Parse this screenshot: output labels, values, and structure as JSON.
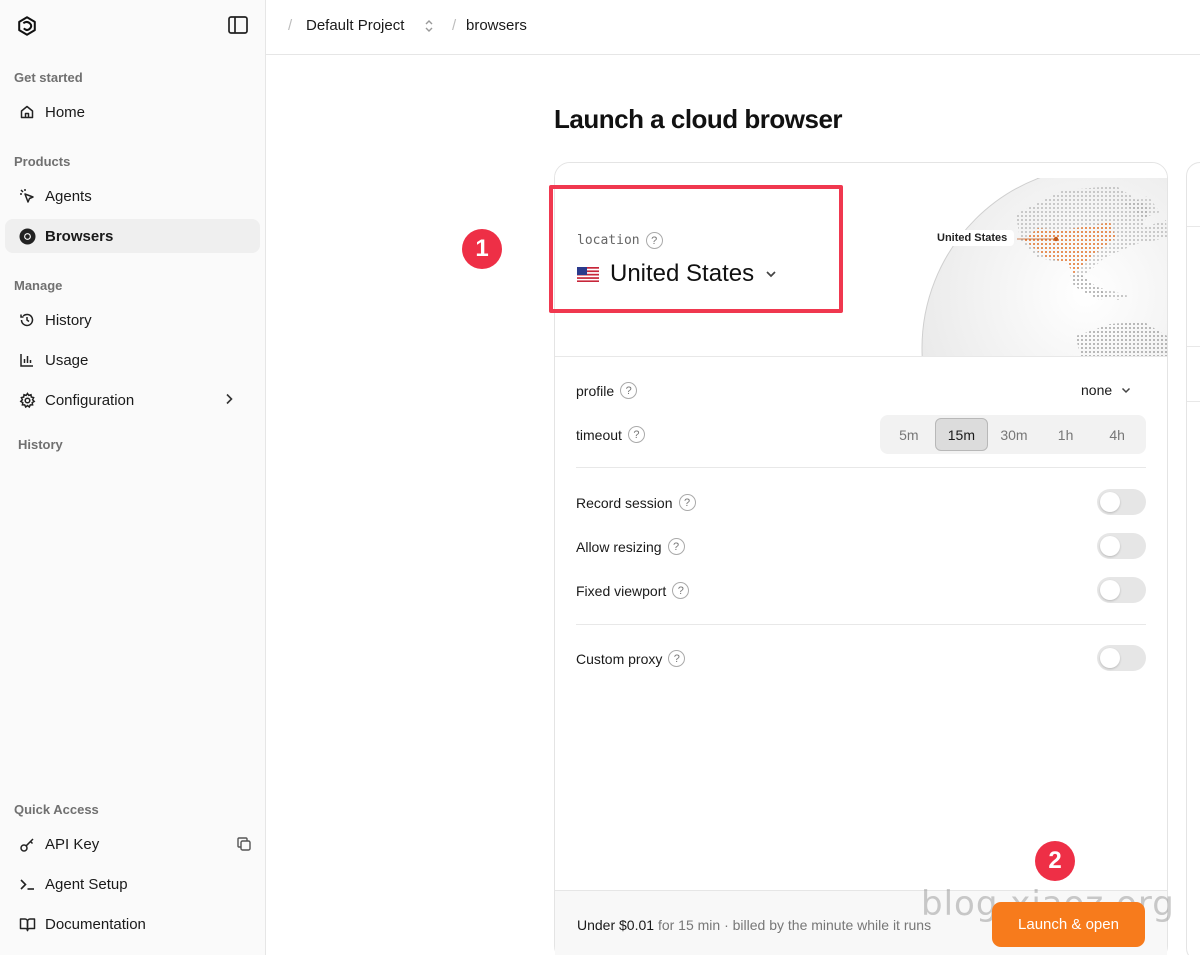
{
  "sidebar": {
    "sections": {
      "get_started": "Get started",
      "products": "Products",
      "manage": "Manage",
      "history": "History",
      "quick_access": "Quick Access"
    },
    "items": {
      "home": "Home",
      "agents": "Agents",
      "browsers": "Browsers",
      "history": "History",
      "usage": "Usage",
      "configuration": "Configuration",
      "api_key": "API Key",
      "agent_setup": "Agent Setup",
      "documentation": "Documentation"
    },
    "active_item": "browsers"
  },
  "header": {
    "project": "Default Project",
    "page": "browsers"
  },
  "main": {
    "title": "Launch a cloud browser",
    "location": {
      "label": "location",
      "value": "United States",
      "map_tag": "United States"
    },
    "profile": {
      "label": "profile",
      "value": "none"
    },
    "timeout": {
      "label": "timeout",
      "options": [
        "5m",
        "15m",
        "30m",
        "1h",
        "4h"
      ],
      "selected": "15m"
    },
    "toggles": {
      "record_session": "Record session",
      "allow_resizing": "Allow resizing",
      "fixed_viewport": "Fixed viewport",
      "custom_proxy": "Custom proxy"
    },
    "footer": {
      "price_bold": "Under $0.01",
      "price_rest": " for 15 min · billed by the minute while it runs",
      "launch_label": "Launch & open"
    }
  },
  "annotations": {
    "badge_1": "1",
    "badge_2": "2"
  },
  "watermark": "blog.xiaoz.org",
  "help_glyph": "?",
  "colors": {
    "accent": "#f77b1c",
    "annotation_red": "#ee2f46",
    "map_highlight": "#e8762c"
  }
}
